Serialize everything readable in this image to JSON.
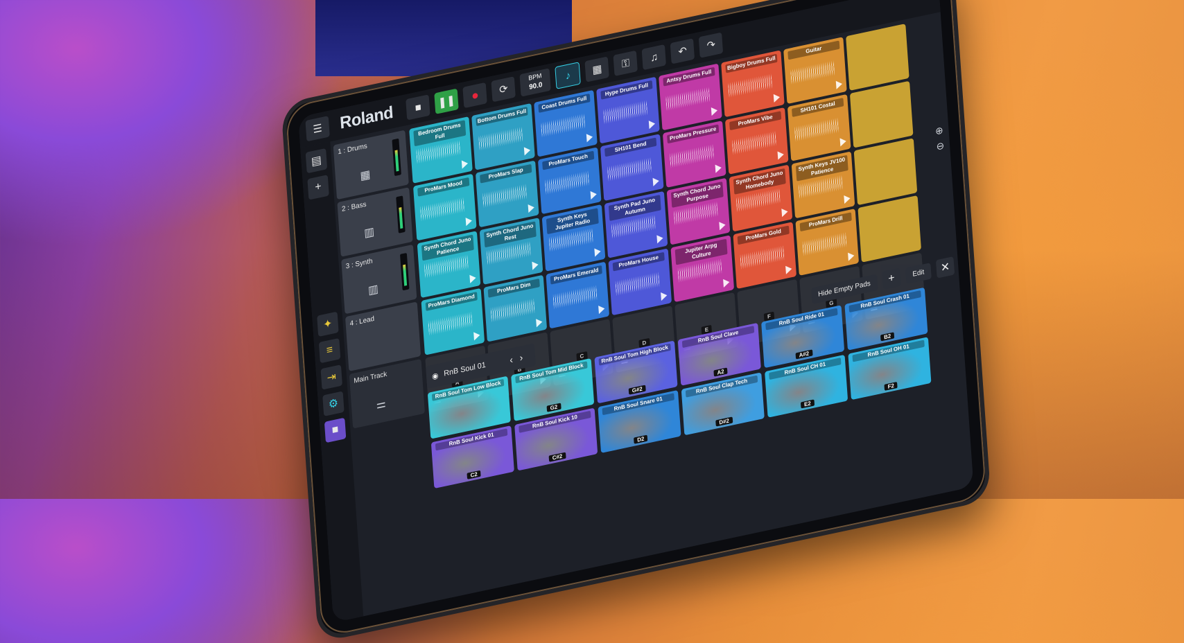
{
  "app": {
    "brand": "Roland"
  },
  "toolbar": {
    "stop": "■",
    "play": "❚❚",
    "rec": "●",
    "loop": "⟳",
    "bpm_label": "BPM",
    "bpm_value": "90.0",
    "undo": "↶",
    "redo": "↷"
  },
  "tracks": [
    {
      "label": "1 : Drums"
    },
    {
      "label": "2 : Bass"
    },
    {
      "label": "3 : Synth"
    },
    {
      "label": "4 : Lead"
    }
  ],
  "main_track": {
    "label": "Main Track"
  },
  "clip_rows": [
    [
      "Bedroom Drums Full",
      "Bottom Drums Full",
      "Coast Drums Full",
      "Hype Drums Full",
      "Antsy Drums Full",
      "Bigboy Drums Full",
      "Guitar",
      ""
    ],
    [
      "ProMars Mood",
      "ProMars Slap",
      "ProMars Touch",
      "SH101 Bend",
      "ProMars Pressure",
      "ProMars Vibe",
      "SH101 Costal",
      ""
    ],
    [
      "Synth Chord Juno Patience",
      "Synth Chord Juno Rest",
      "Synth Keys Jupiter Radio",
      "Synth Pad Juno Autumn",
      "Synth Chord Juno Purpose",
      "Synth Chord Juno Homebody",
      "Synth Keys JV100 Patience",
      ""
    ],
    [
      "ProMars Diamond",
      "ProMars Dim",
      "ProMars Emerald",
      "ProMars House",
      "Jupiter Arpg Culture",
      "ProMars Gold",
      "ProMars Drill",
      ""
    ]
  ],
  "scenes": [
    "A",
    "B",
    "C",
    "D",
    "E",
    "F",
    "G",
    ""
  ],
  "clip_colors": [
    "#2bb5c9",
    "#2fa0c4",
    "#2f78d6",
    "#4e58d8",
    "#c03aa6",
    "#e0563a",
    "#d99032",
    "#c9a233"
  ],
  "pads_header": {
    "hide_empty": "Hide Empty Pads",
    "edit": "Edit",
    "add": "+",
    "close": "✕"
  },
  "kit": {
    "name": "RnB Soul 01"
  },
  "pads": [
    {
      "name": "RnB Soul Tom Low Block",
      "note": "",
      "color": "#38c8d8"
    },
    {
      "name": "RnB Soul Tom Mid Block",
      "note": "G2",
      "color": "#38c8d8"
    },
    {
      "name": "RnB Soul Tom High Block",
      "note": "G#2",
      "color": "#5b62e0"
    },
    {
      "name": "RnB Soul Clave",
      "note": "A2",
      "color": "#7a58d8"
    },
    {
      "name": "RnB Soul Ride 01",
      "note": "A#2",
      "color": "#2f86d8"
    },
    {
      "name": "RnB Soul Crash 01",
      "note": "B2",
      "color": "#2f86d8"
    },
    {
      "name": "RnB Soul Kick 01",
      "note": "C2",
      "color": "#7a58d8"
    },
    {
      "name": "RnB Soul Kick 10",
      "note": "C#2",
      "color": "#7a58d8"
    },
    {
      "name": "RnB Soul Snare 01",
      "note": "D2",
      "color": "#2f86d8"
    },
    {
      "name": "RnB Soul Clap Tech",
      "note": "D#2",
      "color": "#3f9ee0"
    },
    {
      "name": "RnB Soul CH 01",
      "note": "E2",
      "color": "#2fb3e0"
    },
    {
      "name": "RnB Soul OH 01",
      "note": "F2",
      "color": "#2fb3e0"
    }
  ]
}
